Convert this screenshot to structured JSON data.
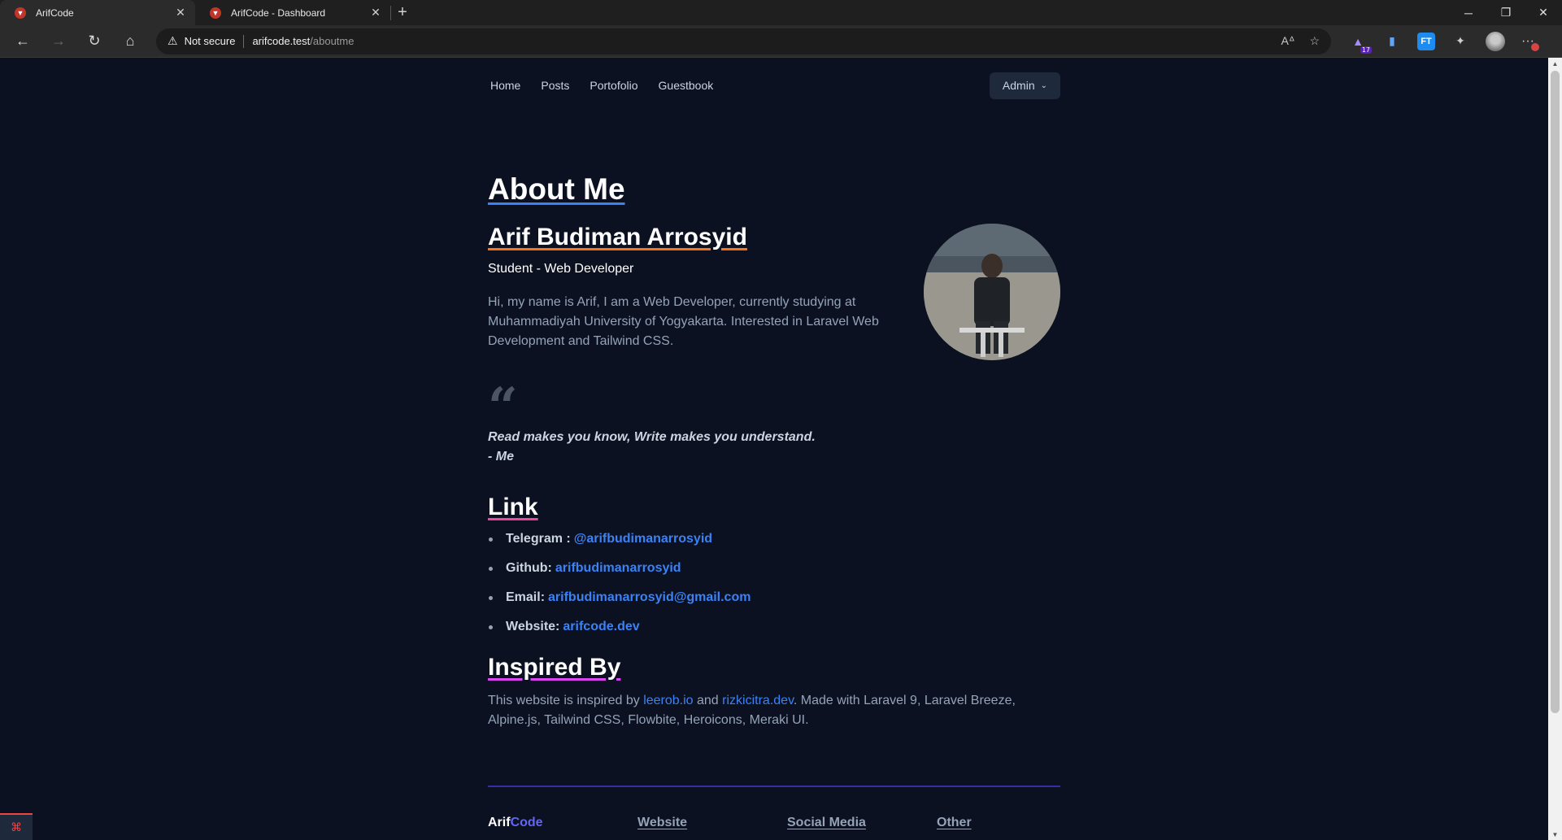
{
  "browser": {
    "tabs": [
      {
        "title": "ArifCode",
        "active": true
      },
      {
        "title": "ArifCode - Dashboard",
        "active": false
      }
    ],
    "security_label": "Not secure",
    "url_host": "arifcode.test",
    "url_path": "/aboutme",
    "ext_badge": "17",
    "ext_ft": "FT"
  },
  "nav": {
    "links": [
      "Home",
      "Posts",
      "Portofolio",
      "Guestbook"
    ],
    "admin_label": "Admin"
  },
  "about": {
    "heading": "About Me",
    "name": "Arif Budiman Arrosyid",
    "role": "Student - Web Developer",
    "bio": "Hi, my name is Arif, I am a Web Developer, currently studying at Muhammadiyah University of Yogyakarta. Interested in Laravel Web Development and Tailwind CSS."
  },
  "quote": {
    "mark": "“",
    "line1": "Read makes you know, Write makes you understand.",
    "line2": "- Me"
  },
  "links_section": {
    "heading": "Link",
    "items": [
      {
        "label": "Telegram :",
        "value": "@arifbudimanarrosyid"
      },
      {
        "label": "Github:",
        "value": "arifbudimanarrosyid"
      },
      {
        "label": "Email:",
        "value": "arifbudimanarrosyid@gmail.com"
      },
      {
        "label": "Website:",
        "value": "arifcode.dev"
      }
    ]
  },
  "inspired": {
    "heading": "Inspired By",
    "text_before": "This website is inspired by ",
    "link1": "leerob.io",
    "text_and": " and ",
    "link2": "rizkicitra.dev",
    "text_after": ". Made with Laravel 9, Laravel Breeze, Alpine.js, Tailwind CSS, Flowbite, Heroicons, Meraki UI."
  },
  "footer": {
    "brand_part1": "Arif",
    "brand_part2": "Code",
    "columns": [
      "Website",
      "Social Media",
      "Other"
    ]
  },
  "colors": {
    "page_bg": "#0b1120",
    "link_blue": "#3b82f6",
    "about_underline": "#3b82f6",
    "name_underline": "#f97316",
    "link_underline": "#ec4899",
    "inspired_underline": "#d946ef",
    "footer_accent": "#6366f1"
  },
  "icons": [
    "back-arrow-icon",
    "forward-arrow-icon",
    "reload-icon",
    "home-icon",
    "warning-icon",
    "read-aloud-icon",
    "favorites-icon",
    "laravel-icon"
  ]
}
